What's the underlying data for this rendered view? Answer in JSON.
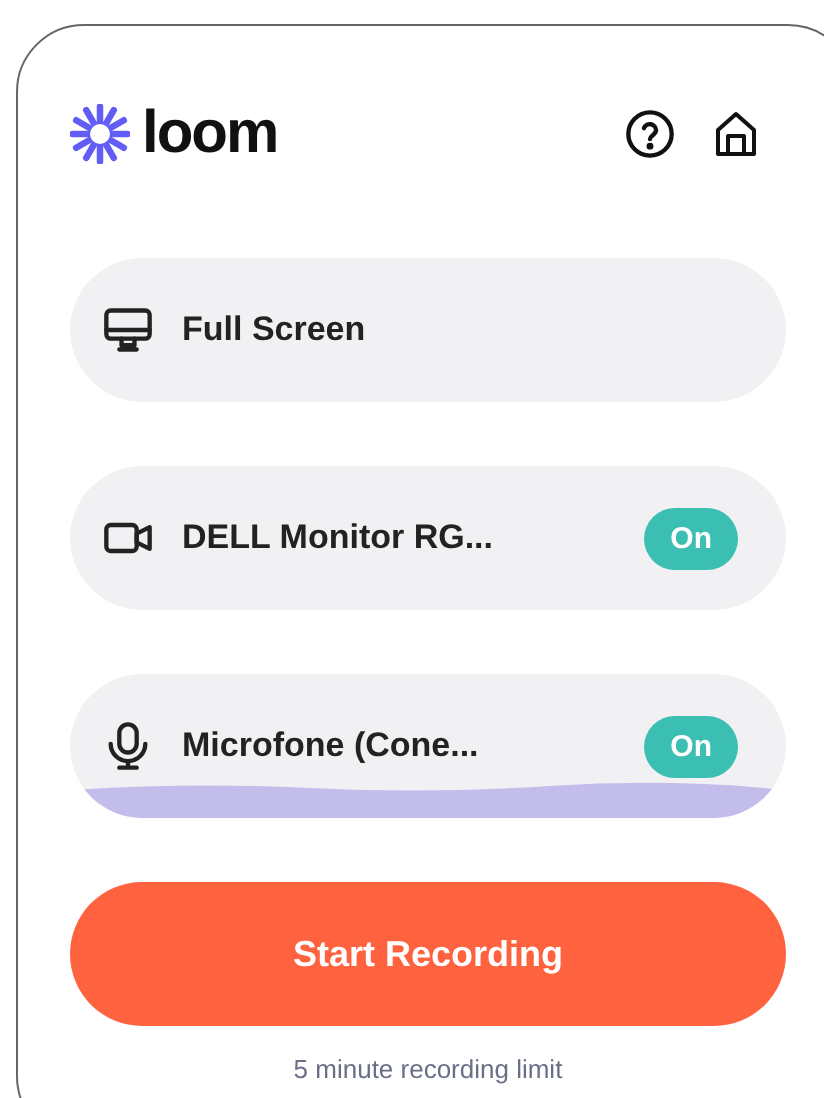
{
  "brand": {
    "name": "loom"
  },
  "sources": [
    {
      "kind": "screen",
      "label": "Full Screen"
    },
    {
      "kind": "camera",
      "label": "DELL Monitor RG...",
      "toggle": {
        "label": "On",
        "on": true
      }
    },
    {
      "kind": "mic",
      "label": "Microfone (Cone...",
      "toggle": {
        "label": "On",
        "on": true
      }
    }
  ],
  "start_button": "Start Recording",
  "footer": "5 minute recording limit"
}
